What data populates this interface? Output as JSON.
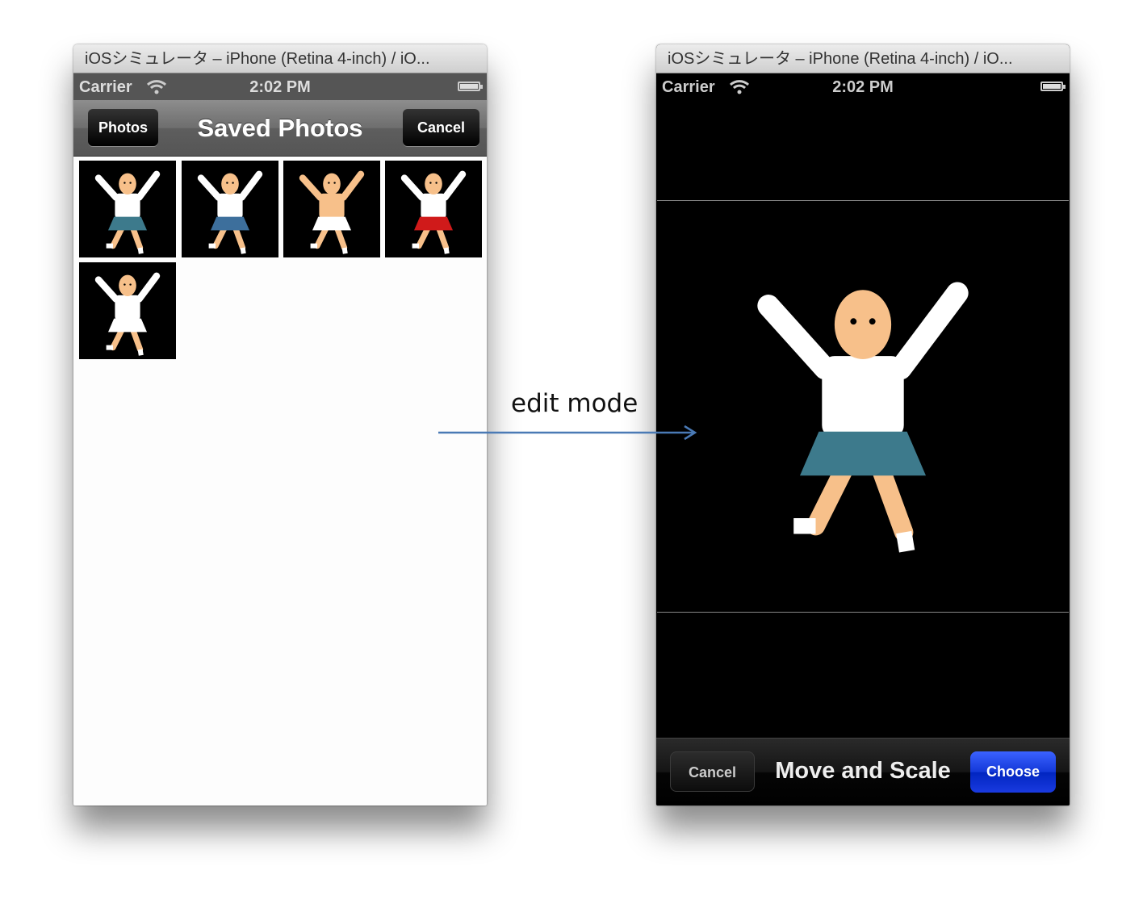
{
  "left_window": {
    "title": "iOSシミュレータ – iPhone (Retina 4-inch) / iO...",
    "status": {
      "carrier": "Carrier",
      "time": "2:02 PM",
      "wifi_icon": "wifi-icon",
      "battery_icon": "battery-icon"
    },
    "nav": {
      "back_label": "Photos",
      "title": "Saved Photos",
      "cancel_label": "Cancel"
    },
    "photos": [
      {
        "desc": "sailor uniform jumping",
        "shirt": "#ffffff",
        "skirt": "#3d7a8c"
      },
      {
        "desc": "sailor uniform dancing",
        "shirt": "#ffffff",
        "skirt": "#3d6f9c"
      },
      {
        "desc": "loincloth",
        "shirt": "#f7c08a",
        "skirt": "#ffffff"
      },
      {
        "desc": "cheerleader",
        "shirt": "#ffffff",
        "skirt": "#d01a1a"
      },
      {
        "desc": "ballerina",
        "shirt": "#ffffff",
        "skirt": "#ffffff"
      }
    ]
  },
  "right_window": {
    "title": "iOSシミュレータ – iPhone (Retina 4-inch) / iO...",
    "status": {
      "carrier": "Carrier",
      "time": "2:02 PM",
      "wifi_icon": "wifi-icon",
      "battery_icon": "battery-icon"
    },
    "toolbar": {
      "cancel_label": "Cancel",
      "title": "Move and Scale",
      "choose_label": "Choose"
    }
  },
  "annotation": {
    "label": "edit mode",
    "arrow_color": "#4a7ab5"
  },
  "colors": {
    "skin": "#f7c08a",
    "choose_button": "#1338d8"
  }
}
